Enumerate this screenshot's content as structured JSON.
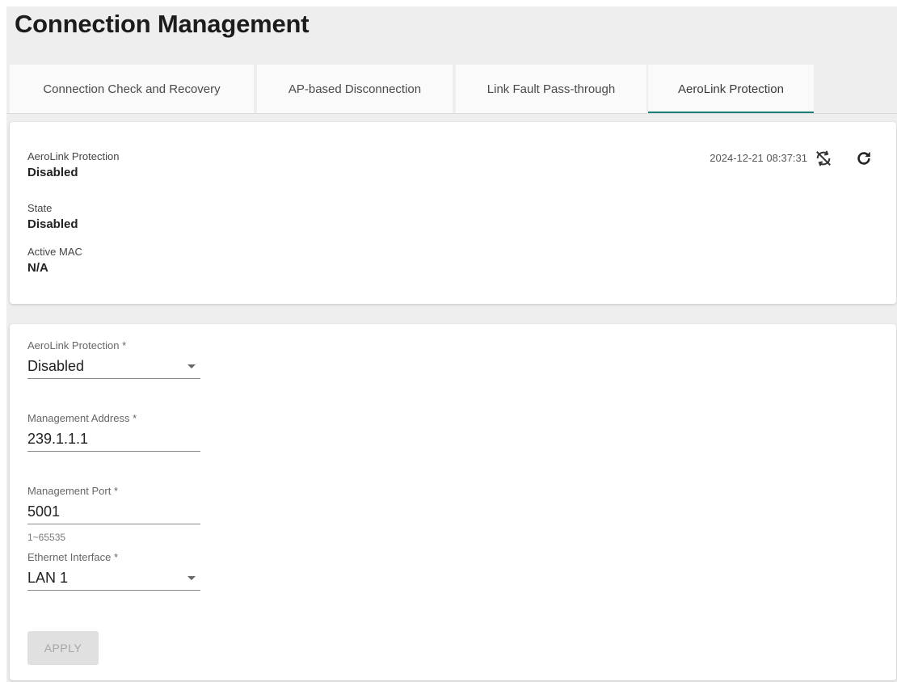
{
  "header": {
    "title": "Connection Management"
  },
  "tabs": [
    {
      "label": "Connection Check and Recovery",
      "active": false
    },
    {
      "label": "AP-based Disconnection",
      "active": false
    },
    {
      "label": "Link Fault Pass-through",
      "active": false
    },
    {
      "label": "AeroLink Protection",
      "active": true
    }
  ],
  "status": {
    "timestamp": "2024-12-21 08:37:31",
    "auto_refresh_icon": "sync-disabled-icon",
    "refresh_icon": "refresh-icon",
    "fields": [
      {
        "label": "AeroLink Protection",
        "value": "Disabled"
      },
      {
        "label": "State",
        "value": "Disabled"
      },
      {
        "label": "Active MAC",
        "value": "N/A"
      }
    ]
  },
  "form": {
    "aerolink_protection": {
      "label": "AeroLink Protection *",
      "value": "Disabled"
    },
    "management_address": {
      "label": "Management Address *",
      "value": "239.1.1.1"
    },
    "management_port": {
      "label": "Management Port *",
      "value": "5001",
      "hint": "1~65535"
    },
    "ethernet_interface": {
      "label": "Ethernet Interface *",
      "value": "LAN 1"
    },
    "apply_label": "APPLY"
  },
  "colors": {
    "accent": "#1e7f7a",
    "background": "#eeeeee"
  }
}
